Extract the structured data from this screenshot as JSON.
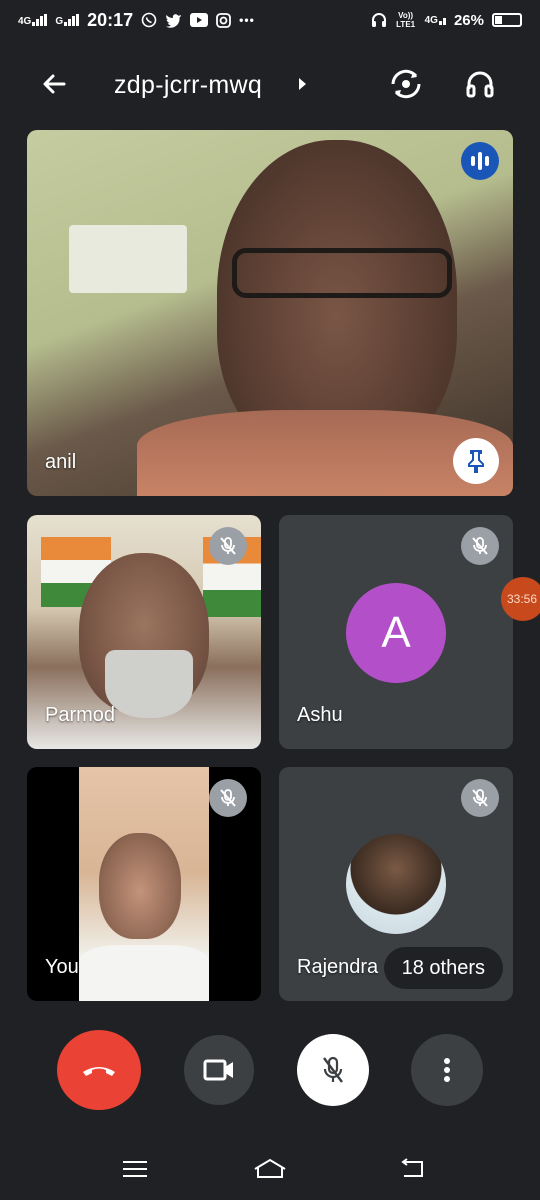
{
  "status_bar": {
    "time": "20:17",
    "net1": "4G",
    "net2": "G",
    "volte": "Vo)) LTE1",
    "net3": "4G",
    "battery": "26%",
    "more": "•••"
  },
  "header": {
    "meeting_code": "zdp-jcrr-mwq"
  },
  "participants": [
    {
      "name": "anil"
    },
    {
      "name": "Parmod"
    },
    {
      "name": "Ashu",
      "initial": "A"
    },
    {
      "name": "You"
    },
    {
      "name": "Rajendra"
    }
  ],
  "others_label": "18 others",
  "timer_bubble": "33:56",
  "colors": {
    "background": "#202124",
    "tile": "#3c4043",
    "end_call": "#ea4335",
    "avatar_ashu": "#b350c9",
    "speaking_badge": "#1a56b8"
  }
}
